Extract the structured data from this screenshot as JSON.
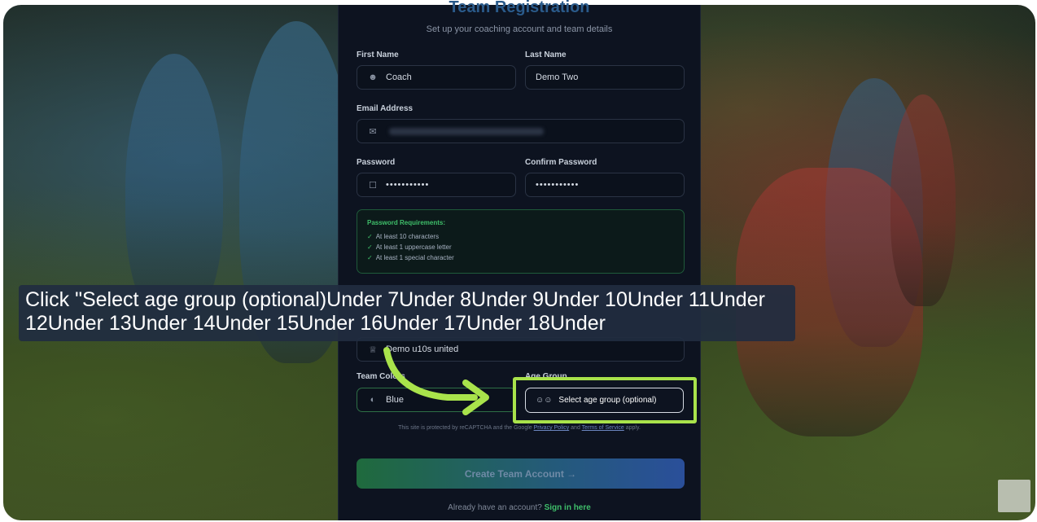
{
  "form": {
    "title": "Team Registration",
    "subtitle": "Set up your coaching account and team details",
    "first_name_label": "First Name",
    "first_name_value": "Coach",
    "last_name_label": "Last Name",
    "last_name_value": "Demo Two",
    "email_label": "Email Address",
    "password_label": "Password",
    "password_value": "•••••••••••",
    "confirm_password_label": "Confirm Password",
    "confirm_password_value": "•••••••••••",
    "requirements": {
      "title": "Password Requirements:",
      "items": [
        "At least 10 characters",
        "At least 1 uppercase letter",
        "At least 1 special character"
      ]
    },
    "team_name_value": "Demo u10s united",
    "team_colors_label": "Team Colors",
    "team_colors_value": "Blue",
    "age_group_label": "Age Group",
    "age_group_placeholder": "Select age group (optional)",
    "recaptcha_prefix": "This site is protected by reCAPTCHA and the Google",
    "privacy_link": "Privacy Policy",
    "and_text": "and",
    "terms_link": "Terms of Service",
    "apply_text": "apply.",
    "create_button": "Create Team Account →",
    "signin_prompt": "Already have an account?",
    "signin_link": "Sign in here"
  },
  "tooltip": {
    "text": "Click \"Select age group (optional)Under 7Under 8Under 9Under 10Under 11Under 12Under 13Under 14Under 15Under 16Under 17Under 18Under"
  },
  "icons": {
    "user": "user-icon",
    "mail": "mail-icon",
    "lock": "lock-icon",
    "trophy": "trophy-icon",
    "palette": "palette-icon",
    "users": "users-icon",
    "arrow": "curved-arrow-icon"
  },
  "colors": {
    "highlight": "#a9e34b",
    "success": "#3fbf6a",
    "panel_bg": "#0d1320"
  }
}
